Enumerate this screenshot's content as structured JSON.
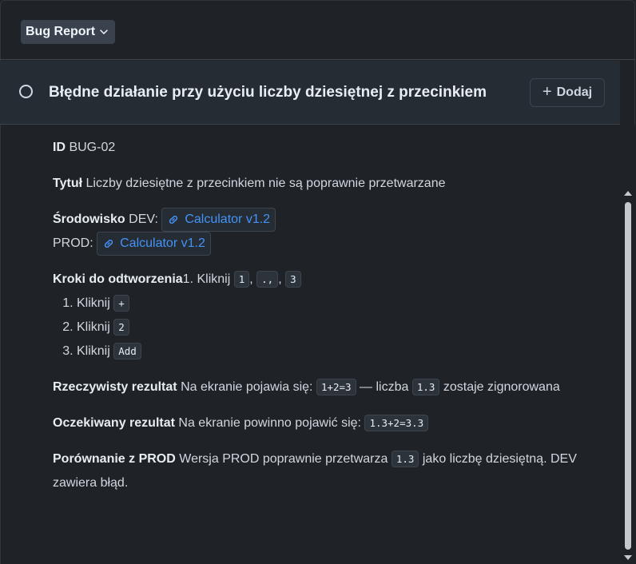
{
  "toolbar": {
    "type_label": "Bug Report",
    "type_icon": "chevron-down-icon"
  },
  "issue": {
    "title": "Błędne działanie przy użyciu liczby dziesiętnej z przecinkiem",
    "status_icon": "open-circle-icon",
    "add_label": "Dodaj",
    "add_icon": "plus-icon"
  },
  "fields": {
    "id": {
      "label": "ID",
      "value": "BUG-02"
    },
    "title": {
      "label": "Tytuł",
      "value": "Liczby dziesiętne z przecinkiem nie są poprawnie przetwarzane"
    },
    "environment": {
      "label": "Środowisko",
      "dev_prefix": "DEV:",
      "dev_link": "Calculator v1.2",
      "prod_prefix": "PROD:",
      "prod_link": "Calculator v1.2"
    },
    "steps": {
      "label": "Kroki do odtworzenia",
      "inline_text": "1. Kliknij",
      "inline_codes": [
        "1",
        ".,",
        "3"
      ],
      "items": [
        {
          "text": "Kliknij",
          "code": "+"
        },
        {
          "text": "Kliknij",
          "code": "2"
        },
        {
          "text": "Kliknij",
          "code": "Add"
        }
      ]
    },
    "actual": {
      "label": "Rzeczywisty rezultat",
      "text1": "Na ekranie pojawia się:",
      "code1": "1+2=3",
      "text2": "— liczba",
      "code2": "1.3",
      "text3": "zostaje zignorowana"
    },
    "expected": {
      "label": "Oczekiwany rezultat",
      "text1": "Na ekranie powinno pojawić się:",
      "code1": "1.3+2=3.3"
    },
    "comparison": {
      "label": "Porównanie z PROD",
      "text1": "Wersja PROD poprawnie przetwarza",
      "code1": "1.3",
      "text2": "jako liczbę dziesiętną. DEV zawiera błąd."
    }
  },
  "colors": {
    "background": "#1f2328",
    "link": "#4493f8",
    "border": "#3d444d"
  }
}
